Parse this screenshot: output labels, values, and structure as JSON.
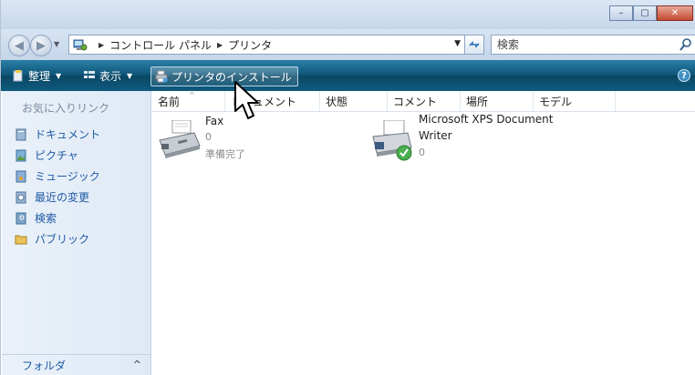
{
  "window": {
    "buttons": {
      "minimize": "–",
      "maximize": "▢",
      "close": "✕"
    }
  },
  "address": {
    "back_label": "◀",
    "forward_label": "▶",
    "breadcrumbs": [
      "コントロール パネル",
      "プリンタ"
    ],
    "search_placeholder": "検索"
  },
  "toolbar": {
    "organize": "整理",
    "view": "表示",
    "install_printer": "プリンタのインストール",
    "help": "?"
  },
  "sidebar": {
    "favorites_title": "お気に入りリンク",
    "links": [
      {
        "label": "ドキュメント",
        "icon": "documents-icon"
      },
      {
        "label": "ピクチャ",
        "icon": "pictures-icon"
      },
      {
        "label": "ミュージック",
        "icon": "music-icon"
      },
      {
        "label": "最近の変更",
        "icon": "recent-changes-icon"
      },
      {
        "label": "検索",
        "icon": "search-folder-icon"
      },
      {
        "label": "パブリック",
        "icon": "public-folder-icon"
      }
    ],
    "folders_label": "フォルダ",
    "folders_chevron": "^"
  },
  "columns": [
    "名前",
    "ドキュメント",
    "状態",
    "コメント",
    "場所",
    "モデル"
  ],
  "printers": [
    {
      "name": "Fax",
      "documents": "0",
      "status": "準備完了"
    },
    {
      "name_line1": "Microsoft XPS Document",
      "name_line2": "Writer",
      "documents": "0"
    }
  ],
  "colors": {
    "toolbar": "#0e5578",
    "link": "#1f59a6",
    "sidebar_bg": "#e4edf7"
  }
}
